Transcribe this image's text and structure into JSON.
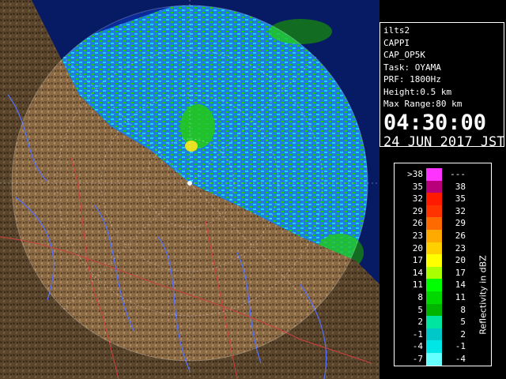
{
  "info": {
    "lines": [
      "ilts2",
      "CAPPI",
      "CAP_OP5K",
      "Task: OYAMA",
      "PRF: 1800Hz",
      "Height:0.5 km",
      "Max Range:80 km"
    ],
    "time": "04:30:00",
    "date": "24 JUN 2017 JST"
  },
  "legend": {
    "title": "Reflectivity in dBZ",
    "rows": [
      {
        "low": ">38",
        "high": "---",
        "color": "#ff33ff"
      },
      {
        "low": "35",
        "high": "38",
        "color": "#b8007a"
      },
      {
        "low": "32",
        "high": "35",
        "color": "#ff1a00"
      },
      {
        "low": "29",
        "high": "32",
        "color": "#ff3300"
      },
      {
        "low": "26",
        "high": "29",
        "color": "#ff6a00"
      },
      {
        "low": "23",
        "high": "26",
        "color": "#ffaa00"
      },
      {
        "low": "20",
        "high": "23",
        "color": "#ffd000"
      },
      {
        "low": "17",
        "high": "20",
        "color": "#ffff00"
      },
      {
        "low": "14",
        "high": "17",
        "color": "#aaff00"
      },
      {
        "low": "11",
        "high": "14",
        "color": "#00ff00"
      },
      {
        "low": "8",
        "high": "11",
        "color": "#00d800"
      },
      {
        "low": "5",
        "high": "8",
        "color": "#00b400"
      },
      {
        "low": "2",
        "high": "5",
        "color": "#00e6a0"
      },
      {
        "low": "-1",
        "high": "2",
        "color": "#00c8c8"
      },
      {
        "low": "-4",
        "high": "-1",
        "color": "#00e6e6"
      },
      {
        "low": "-7",
        "high": "-4",
        "color": "#66ffff"
      }
    ]
  },
  "colors": {
    "sea": "#0a2a9a",
    "land": "#8a6b45",
    "echo_blue": "#1f7fe0",
    "echo_cyan": "#1ad8e6",
    "echo_green": "#22c81e",
    "echo_yellow": "#e8e020",
    "river": "#5570ff",
    "boundary": "#d04040"
  }
}
